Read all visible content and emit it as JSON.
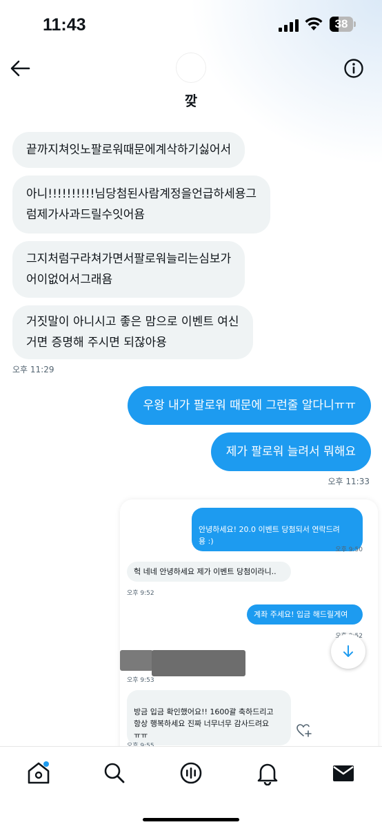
{
  "status_bar": {
    "time": "11:43",
    "battery": "38",
    "battery_level": 0.38
  },
  "header": {
    "title": "깢"
  },
  "messages_in": [
    {
      "text": "끝까지쳐잇노팔로워때문에계삭하기싫어서"
    },
    {
      "text": "아니!!!!!!!!!!님당첨된사람계정을언급하세용그\n럼제가사과드릴수잇어욤"
    },
    {
      "text": "그지처럼구라쳐가면서팔로워늘리는심보가\n어이없어서그래욤"
    },
    {
      "text": "거짓말이 아니시고 좋은 맘으로 이벤트 여신\n거면 증명해 주시면 되잖아용"
    }
  ],
  "timestamp_in": "오후 11:29",
  "messages_out": [
    {
      "text": "우왕 내가 팔로워 때문에 그런줄 알다니ㅠㅠ"
    },
    {
      "text": "제가 팔로워 늘려서 뭐해요"
    }
  ],
  "timestamp_out": "오후 11:33",
  "embedded_screenshot": {
    "out_1": "안녕하세요! 20.0 이벤트 당첨되서 연락드려\n용 :)",
    "ts_1": "오후 9:50",
    "in_1": "헉 네네 안녕하세요 제가 이벤트 당첨이라니..",
    "ts_2": "오후 9:52",
    "out_2": "계좌 주세요! 입금 해드릴게여",
    "ts_3": "오후 9:52",
    "ts_4": "오후 9:53",
    "in_2": "방금 입금 확인했어요!! 1600괄 축하드리고\n항상 행복하세요 진짜 너무너무 감사드려요\nㅠㅠ",
    "ts_5": "오후 9:55"
  },
  "icons": {
    "back": "back-arrow-icon",
    "info": "info-icon",
    "scroll_down": "arrow-down-icon",
    "react": "heart-plus-icon",
    "nav": [
      "home-icon",
      "search-icon",
      "spaces-icon",
      "bell-icon",
      "mail-icon"
    ]
  },
  "colors": {
    "accent": "#1d9bf0",
    "bubble_in": "#eff3f4",
    "text": "#0f1419",
    "muted": "#536471"
  }
}
